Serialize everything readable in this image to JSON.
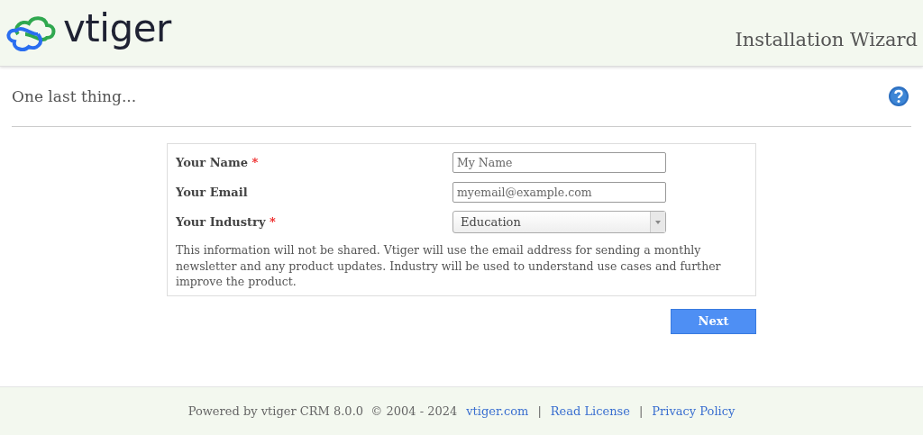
{
  "header": {
    "logo_text": "vtiger",
    "title": "Installation Wizard"
  },
  "page": {
    "heading": "One last thing..."
  },
  "form": {
    "fields": [
      {
        "kind": "text",
        "label": "Your Name",
        "required": true,
        "placeholder": "My Name"
      },
      {
        "kind": "text",
        "label": "Your Email",
        "required": false,
        "placeholder": "myemail@example.com"
      },
      {
        "kind": "select",
        "label": "Your Industry",
        "required": true,
        "value": "Education"
      }
    ],
    "required_mark": "*",
    "note": "This information will not be shared. Vtiger will use the email address for sending a monthly newsletter and any product updates. Industry will be used to understand use cases and further improve the product."
  },
  "next_button": "Next",
  "footer": {
    "text": "Powered by vtiger CRM 8.0.0  © 2004 - 2024",
    "links": [
      "vtiger.com",
      "Read License",
      "Privacy Policy"
    ],
    "separator": "|"
  }
}
